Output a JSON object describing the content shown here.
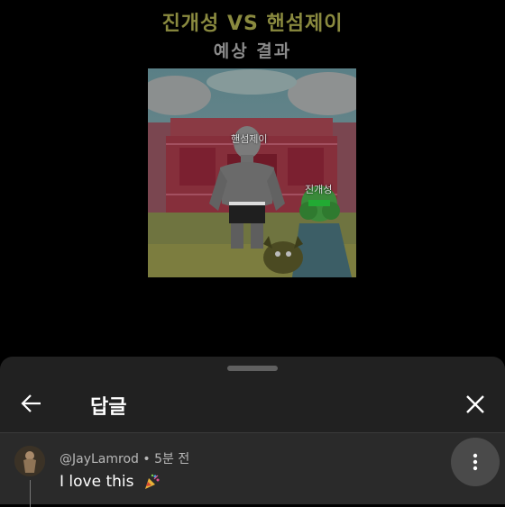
{
  "video": {
    "title_line1": "진개성 VS 핸섬제이",
    "title_line2": "예상 결과",
    "label_handsome": "핸섬제이",
    "label_jin": "진개성"
  },
  "replies_panel": {
    "title": "답글",
    "back_icon": "arrow-left-icon",
    "close_icon": "close-icon"
  },
  "comment": {
    "author": "@JayLamrod",
    "separator": " • ",
    "time": "5분 전",
    "text": "I love this",
    "emoji_icon": "party-popper-icon",
    "more_icon": "more-vertical-icon"
  },
  "colors": {
    "panel_bg": "#212121",
    "comment_bg": "#2a2a2a",
    "title1": "#8a8a3f",
    "title2": "#8b8b8b"
  }
}
